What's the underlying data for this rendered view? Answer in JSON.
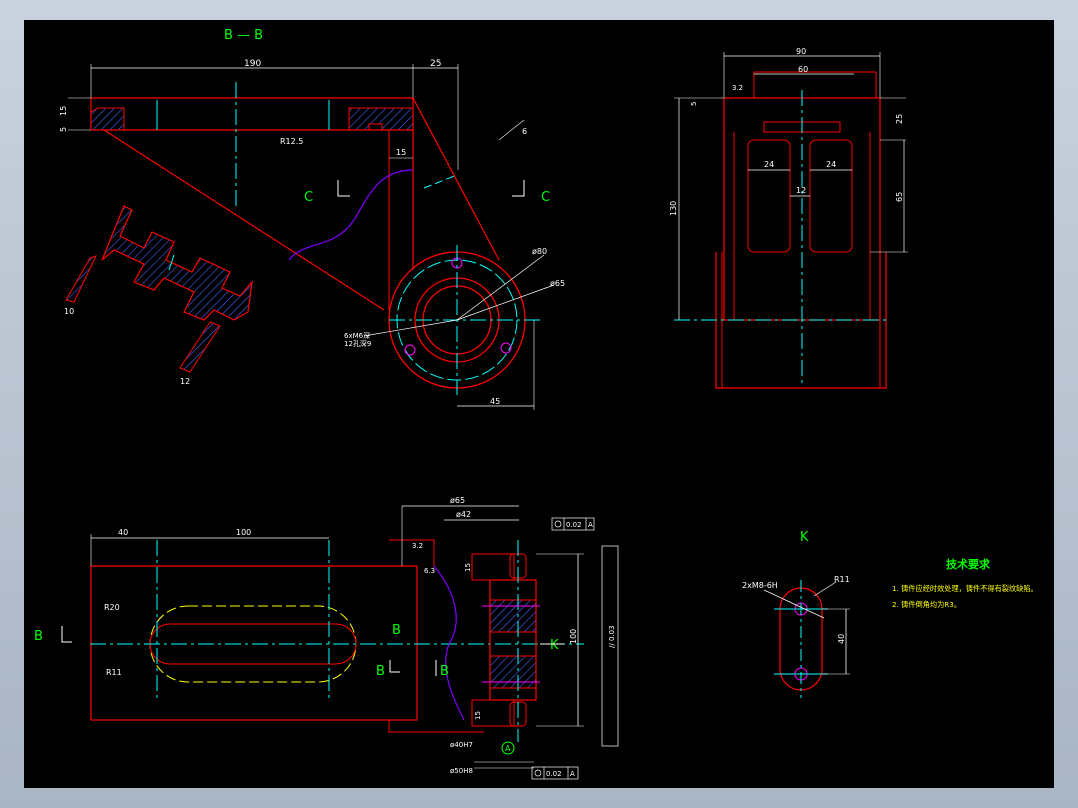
{
  "view_labels": {
    "section_bb": "B — B",
    "section_c_left": "C",
    "section_c_right": "C",
    "view_k": "K",
    "b_left": "B",
    "b_mid": "B",
    "b_mid2": "B",
    "b_right": "B",
    "k_arrow": "K"
  },
  "dims": {
    "d190": "190",
    "d25": "25",
    "d15v": "15",
    "d5": "5",
    "d15h": "15",
    "r12_5": "R12.5",
    "d6": "6",
    "d10": "10",
    "d12a": "12",
    "phi80": "ø80",
    "phi65": "ø65",
    "thread_note1": "6xM6深",
    "thread_note2": "12孔深9",
    "d45": "45",
    "d90": "90",
    "d60": "60",
    "d3_2a": "3.2",
    "d5b": "5",
    "d25b": "25",
    "d24a": "24",
    "d24b": "24",
    "d12b": "12",
    "d65": "65",
    "d130": "130",
    "d40": "40",
    "d100": "100",
    "r20": "R20",
    "r11": "R11",
    "phi65b": "ø65",
    "phi42": "ø42",
    "tol1": "0.02",
    "datum1": "A",
    "d3_2b": "3.2",
    "d6_3": "6.3",
    "d15c": "15",
    "d15d": "15",
    "d100v": "100",
    "par_tol": "// 0.03",
    "phi40h7": "ø40H7",
    "phi50h8": "ø50H8",
    "tol2": "0.02",
    "datum2": "A",
    "datum_a": "A",
    "k_thread": "2xM8-6H",
    "k_r11": "R11",
    "k_40": "40"
  },
  "notes": {
    "title": "技术要求",
    "line1": "1. 铸件应经时效处理，铸件不得有裂纹缺陷。",
    "line2": "2. 铸件倒角均为R3。"
  },
  "colors": {
    "frame_bg": "#000000",
    "outline": "#ff0000",
    "dimension": "#ffffff",
    "centerline": "#00ffff",
    "label": "#00ff00",
    "note_text": "#ffff00",
    "hatch": "#4060ff",
    "break_line": "#8000ff",
    "hidden": "#ffff00"
  }
}
